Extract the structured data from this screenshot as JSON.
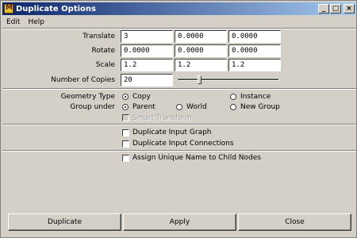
{
  "window": {
    "title": "Duplicate Options",
    "controls": {
      "minimize": "_",
      "maximize": "□",
      "close": "×"
    }
  },
  "menu": {
    "edit": "Edit",
    "help": "Help"
  },
  "fields": {
    "translate": {
      "label": "Translate",
      "values": [
        "3",
        "0.0000",
        "0.0000"
      ]
    },
    "rotate": {
      "label": "Rotate",
      "values": [
        "0.0000",
        "0.0000",
        "0.0000"
      ]
    },
    "scale": {
      "label": "Scale",
      "values": [
        "1.2",
        "1.2",
        "1.2"
      ]
    },
    "copies": {
      "label": "Number of Copies",
      "value": "20",
      "slider_fraction": 0.2
    }
  },
  "geometry_type": {
    "label": "Geometry Type",
    "copy": "Copy",
    "instance": "Instance",
    "selected": "Copy"
  },
  "group_under": {
    "label": "Group under",
    "parent": "Parent",
    "world": "World",
    "new_group": "New Group",
    "selected": "Parent"
  },
  "options": {
    "smart_transform": "Smart Transform",
    "dup_input_graph": "Duplicate Input Graph",
    "dup_input_connections": "Duplicate Input Connections",
    "assign_unique_name": "Assign Unique Name to Child Nodes"
  },
  "buttons": {
    "duplicate": "Duplicate",
    "apply": "Apply",
    "close": "Close"
  }
}
